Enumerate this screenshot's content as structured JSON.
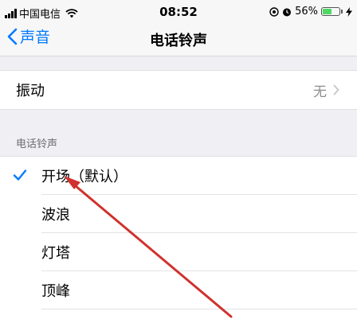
{
  "status_bar": {
    "carrier": "中国电信",
    "time": "08:52",
    "battery_percent": "56%",
    "battery_level": 0.56,
    "icons": [
      "signal-icon",
      "wifi-icon",
      "location-icon",
      "alarm-icon",
      "battery-icon",
      "charging-icon"
    ]
  },
  "nav": {
    "back_label": "声音",
    "title": "电话铃声"
  },
  "vibration": {
    "label": "振动",
    "value": "无"
  },
  "ringtones": {
    "header": "电话铃声",
    "items": [
      {
        "label": "开场（默认）",
        "selected": true
      },
      {
        "label": "波浪",
        "selected": false
      },
      {
        "label": "灯塔",
        "selected": false
      },
      {
        "label": "顶峰",
        "selected": false
      }
    ]
  },
  "colors": {
    "accent": "#007aff",
    "annotation": "#d0312d",
    "battery": "#4cd964"
  }
}
